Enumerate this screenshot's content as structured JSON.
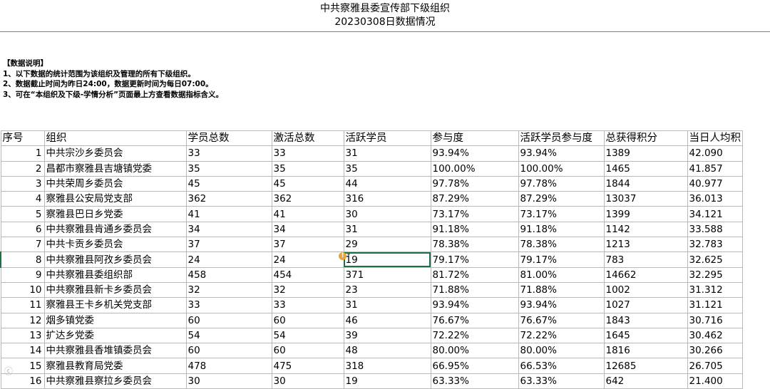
{
  "header": {
    "title": "中共察雅县委宣传部下级组织",
    "subtitle": "20230308日数据情况"
  },
  "notes": [
    "【数据说明】",
    "1、以下数据的统计范围为该组织及管理的所有下级组织。",
    "2、数据截止时间为昨日24:00，数据更新时间为每日07:00。",
    "3、可在“本组织及下级-学情分析”页面最上方查看数据指标含义。"
  ],
  "table": {
    "headers": [
      "序号",
      "组织",
      "学员总数",
      "激活总数",
      "活跃学员",
      "参与度",
      "活跃学员参与度",
      "总获得积分",
      "当日人均积"
    ],
    "rows": [
      [
        "1",
        "中共宗沙乡委员会",
        "33",
        "33",
        "31",
        "93.94%",
        "93.94%",
        "1389",
        "42.090"
      ],
      [
        "2",
        "昌都市察雅县吉塘镇党委",
        "35",
        "35",
        "35",
        "100.00%",
        "100.00%",
        "1465",
        "41.857"
      ],
      [
        "3",
        "中共荣周乡委员会",
        "45",
        "45",
        "44",
        "97.78%",
        "97.78%",
        "1844",
        "40.977"
      ],
      [
        "4",
        "察雅县公安局党支部",
        "362",
        "362",
        "316",
        "87.29%",
        "87.29%",
        "13037",
        "36.013"
      ],
      [
        "5",
        "察雅县巴日乡党委",
        "41",
        "41",
        "30",
        "73.17%",
        "73.17%",
        "1399",
        "34.121"
      ],
      [
        "6",
        "中共察雅县肯通乡委员会",
        "34",
        "34",
        "31",
        "91.18%",
        "91.18%",
        "1142",
        "33.588"
      ],
      [
        "7",
        "中共卡贡乡委员会",
        "37",
        "37",
        "29",
        "78.38%",
        "78.38%",
        "1213",
        "32.783"
      ],
      [
        "8",
        "中共察雅县阿孜乡委员会",
        "24",
        "24",
        "19",
        "79.17%",
        "79.17%",
        "783",
        "32.625"
      ],
      [
        "9",
        "中共察雅县委组织部",
        "458",
        "454",
        "371",
        "81.72%",
        "81.00%",
        "14662",
        "32.295"
      ],
      [
        "10",
        "中共察雅县新卡乡委员会",
        "32",
        "32",
        "23",
        "71.88%",
        "71.88%",
        "1002",
        "31.312"
      ],
      [
        "11",
        "察雅县王卡乡机关党支部",
        "33",
        "33",
        "31",
        "93.94%",
        "93.94%",
        "1027",
        "31.121"
      ],
      [
        "12",
        "烟多镇党委",
        "60",
        "60",
        "46",
        "76.67%",
        "76.67%",
        "1843",
        "30.716"
      ],
      [
        "13",
        "扩达乡党委",
        "54",
        "54",
        "39",
        "72.22%",
        "72.22%",
        "1645",
        "30.462"
      ],
      [
        "14",
        "中共察雅县香堆镇委员会",
        "60",
        "60",
        "48",
        "80.00%",
        "80.00%",
        "1816",
        "30.266"
      ],
      [
        "15",
        "察雅县教育局党委",
        "478",
        "475",
        "318",
        "66.95%",
        "66.53%",
        "12685",
        "26.705"
      ],
      [
        "16",
        "中共察雅县察拉乡委员会",
        "30",
        "30",
        "19",
        "63.33%",
        "63.33%",
        "642",
        "21.400"
      ]
    ],
    "selected_row": 8,
    "selected_col": 4
  },
  "icons": {
    "warning": "warning-icon",
    "warning_glyph": "!"
  },
  "colors": {
    "selection": "#1e7145",
    "warning": "#e8a33d",
    "gridline": "#b8b8b8"
  }
}
